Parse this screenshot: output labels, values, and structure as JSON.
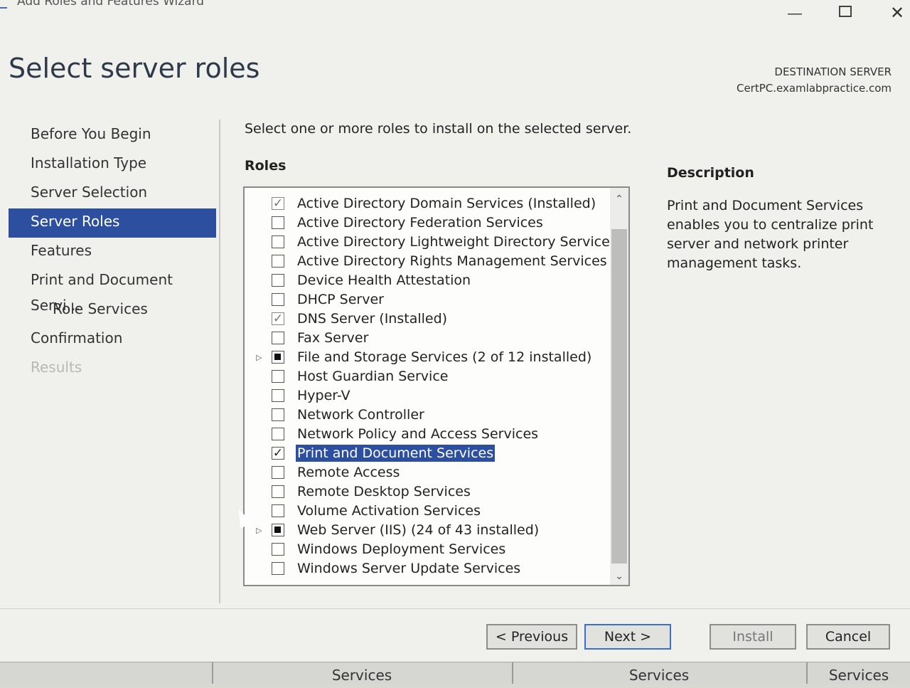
{
  "window": {
    "title": "Add Roles and Features Wizard"
  },
  "page": {
    "title": "Select server roles",
    "destination_label": "DESTINATION SERVER",
    "destination_name": "CertPC.examlabpractice.com"
  },
  "nav": {
    "items": [
      {
        "label": "Before You Begin",
        "state": "normal"
      },
      {
        "label": "Installation Type",
        "state": "normal"
      },
      {
        "label": "Server Selection",
        "state": "normal"
      },
      {
        "label": "Server Roles",
        "state": "active"
      },
      {
        "label": "Features",
        "state": "normal"
      },
      {
        "label": "Print and Document Servi...",
        "state": "normal"
      },
      {
        "label": "Role Services",
        "state": "sub"
      },
      {
        "label": "Confirmation",
        "state": "normal"
      },
      {
        "label": "Results",
        "state": "disabled"
      }
    ]
  },
  "main": {
    "instruction": "Select one or more roles to install on the selected server.",
    "roles_heading": "Roles",
    "roles": [
      {
        "label": "Active Directory Domain Services (Installed)",
        "check": "installed",
        "expander": false
      },
      {
        "label": "Active Directory Federation Services",
        "check": "none",
        "expander": false
      },
      {
        "label": "Active Directory Lightweight Directory Services",
        "check": "none",
        "expander": false
      },
      {
        "label": "Active Directory Rights Management Services",
        "check": "none",
        "expander": false
      },
      {
        "label": "Device Health Attestation",
        "check": "none",
        "expander": false
      },
      {
        "label": "DHCP Server",
        "check": "none",
        "expander": false
      },
      {
        "label": "DNS Server (Installed)",
        "check": "installed",
        "expander": false
      },
      {
        "label": "Fax Server",
        "check": "none",
        "expander": false
      },
      {
        "label": "File and Storage Services (2 of 12 installed)",
        "check": "partial",
        "expander": true
      },
      {
        "label": "Host Guardian Service",
        "check": "none",
        "expander": false
      },
      {
        "label": "Hyper-V",
        "check": "none",
        "expander": false
      },
      {
        "label": "Network Controller",
        "check": "none",
        "expander": false
      },
      {
        "label": "Network Policy and Access Services",
        "check": "none",
        "expander": false
      },
      {
        "label": "Print and Document Services",
        "check": "checked",
        "expander": false,
        "selected": true
      },
      {
        "label": "Remote Access",
        "check": "none",
        "expander": false
      },
      {
        "label": "Remote Desktop Services",
        "check": "none",
        "expander": false
      },
      {
        "label": "Volume Activation Services",
        "check": "none",
        "expander": false
      },
      {
        "label": "Web Server (IIS) (24 of 43 installed)",
        "check": "partial",
        "expander": true
      },
      {
        "label": "Windows Deployment Services",
        "check": "none",
        "expander": false
      },
      {
        "label": "Windows Server Update Services",
        "check": "none",
        "expander": false
      }
    ]
  },
  "description": {
    "heading": "Description",
    "text": "Print and Document Services enables you to centralize print server and network printer management tasks."
  },
  "buttons": {
    "previous": "< Previous",
    "next": "Next >",
    "install": "Install",
    "cancel": "Cancel"
  },
  "taskbar": {
    "tabs": [
      "Services",
      "Services",
      "Services"
    ]
  },
  "colors": {
    "selection": "#2d4fa0",
    "background": "#f0f0ec"
  }
}
